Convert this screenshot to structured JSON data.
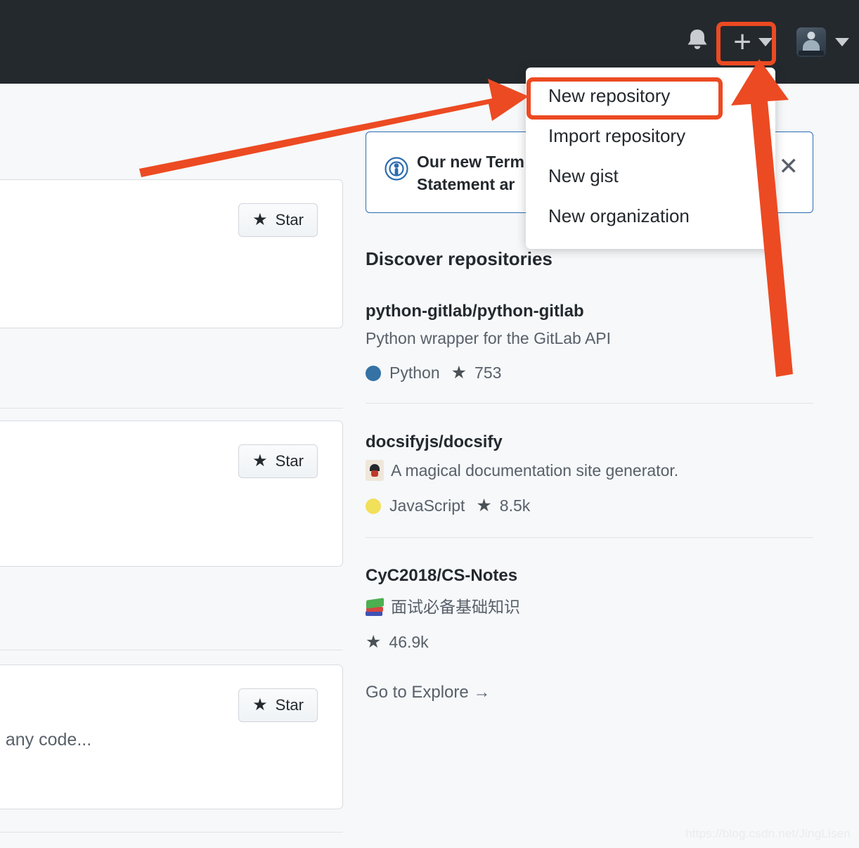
{
  "header": {
    "notifications_icon": "bell-icon",
    "create_new_label": "+",
    "create_new_caret": "▾",
    "avatar_alt": "user-avatar",
    "avatar_caret": "▾"
  },
  "menu": {
    "items": [
      {
        "label": "New repository",
        "highlighted": true
      },
      {
        "label": "Import repository",
        "highlighted": false
      },
      {
        "label": "New gist",
        "highlighted": false
      },
      {
        "label": "New organization",
        "highlighted": false
      }
    ]
  },
  "announcement": {
    "icon": "broadcast-icon",
    "line1": "Our new Term",
    "line2": "Statement ar",
    "close_label": "✕"
  },
  "discover": {
    "title": "Discover repositories",
    "explore_link": "Go to Explore →",
    "repos": [
      {
        "name": "python-gitlab/python-gitlab",
        "description": "Python wrapper for the GitLab API",
        "emoji": "",
        "language": "Python",
        "language_color": "#3572A5",
        "stars": "753"
      },
      {
        "name": "docsifyjs/docsify",
        "description": "A magical documentation site generator.",
        "emoji": "joker-card-emoji",
        "language": "JavaScript",
        "language_color": "#f1e05a",
        "stars": "8.5k"
      },
      {
        "name": "CyC2018/CS-Notes",
        "description": "面试必备基础知识",
        "emoji": "books-emoji",
        "language": "",
        "language_color": "",
        "stars": "46.9k"
      }
    ]
  },
  "left_cards": [
    {
      "star_label": "Star",
      "text": ""
    },
    {
      "star_label": "Star",
      "text": ""
    },
    {
      "star_label": "Star",
      "text": "e any code..."
    }
  ],
  "annotations": {
    "accent_color": "#ec4a22",
    "arrow_to_new_repository": "arrow-pointing-to-new-repository",
    "arrow_to_plus_button": "arrow-pointing-to-plus-button"
  },
  "watermark": "https://blog.csdn.net/JingLisen",
  "star_glyph": "★"
}
